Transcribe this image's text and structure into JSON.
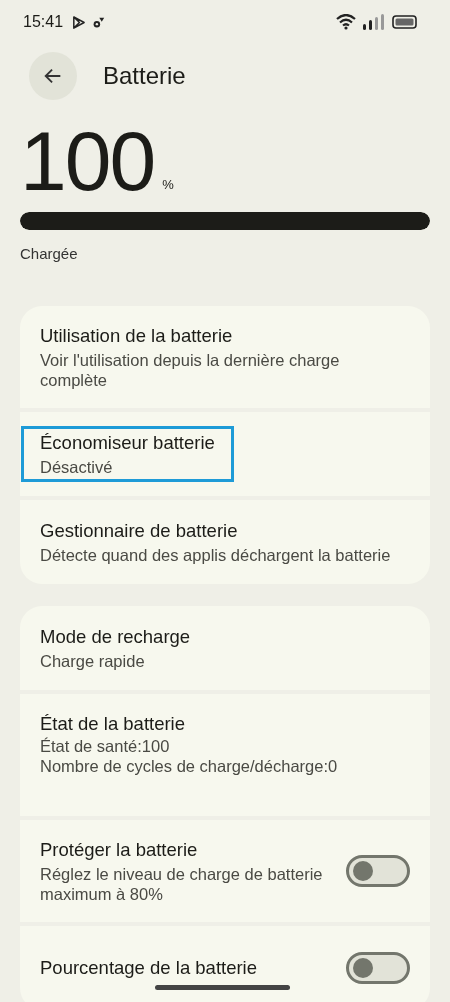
{
  "status_bar": {
    "time": "15:41"
  },
  "header": {
    "title": "Batterie"
  },
  "battery": {
    "percent": "100",
    "unit": "%",
    "level": 1,
    "status": "Chargée"
  },
  "groups": [
    {
      "items": [
        {
          "kind": "link",
          "title": "Utilisation de la batterie",
          "subtitle": "Voir l'utilisation depuis la dernière charge complète",
          "selected": false
        },
        {
          "kind": "link",
          "title": "Économiseur batterie",
          "subtitle": "Désactivé",
          "selected": true
        },
        {
          "kind": "link",
          "title": "Gestionnaire de batterie",
          "subtitle": "Détecte quand des applis déchargent la batterie",
          "selected": false
        }
      ]
    },
    {
      "items": [
        {
          "kind": "link",
          "title": "Mode de recharge",
          "subtitle": "Charge rapide",
          "selected": false
        },
        {
          "kind": "info",
          "title": "État de la batterie",
          "lines": [
            "État de santé:100",
            "Nombre de cycles de charge/décharge:0"
          ],
          "selected": false
        },
        {
          "kind": "toggle",
          "title": "Protéger la batterie",
          "subtitle": "Réglez le niveau de charge de batterie maximum à 80%",
          "on": false,
          "selected": false
        },
        {
          "kind": "toggle",
          "title": "Pourcentage de la batterie",
          "on": false,
          "selected": false
        }
      ]
    }
  ]
}
